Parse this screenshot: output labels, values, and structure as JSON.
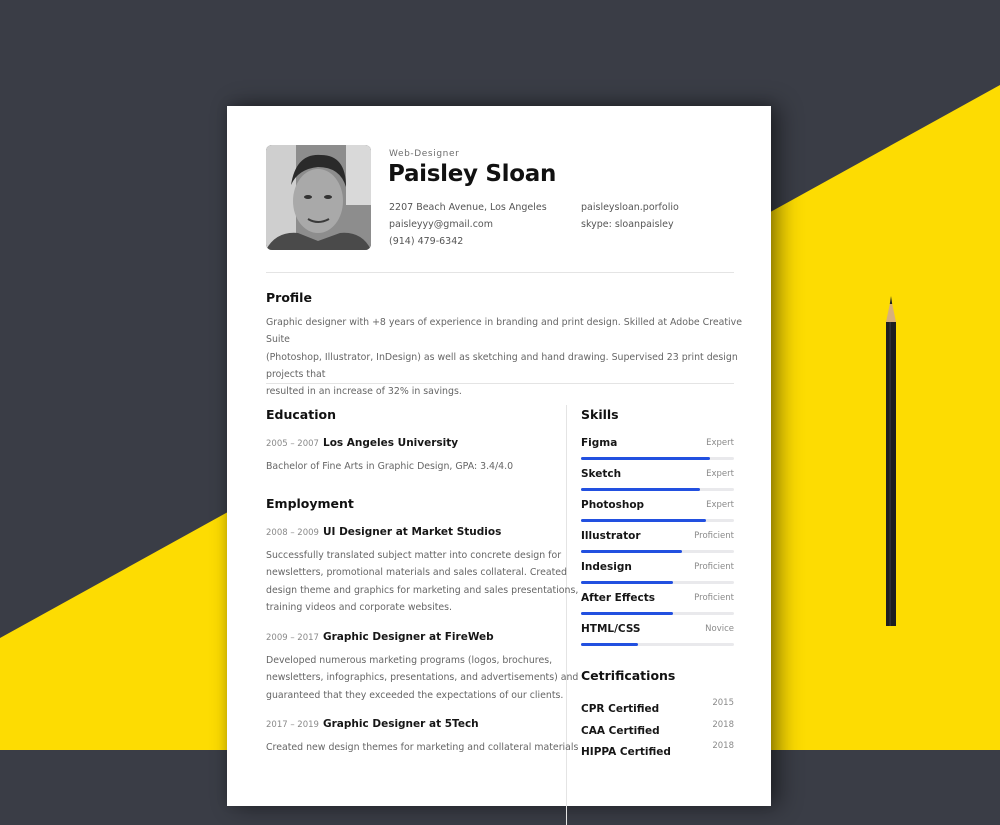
{
  "colors": {
    "background_dark": "#3a3d46",
    "background_yellow": "#fddc02",
    "accent_blue": "#2250e0",
    "paper": "#ffffff"
  },
  "header": {
    "role": "Web-Designer",
    "name": "Paisley Sloan",
    "address": "2207 Beach Avenue, Los Angeles",
    "email": "paisleyyy@gmail.com",
    "phone": "(914) 479-6342",
    "portfolio": "paisleysloan.porfolio",
    "skype": "skype: sloanpaisley"
  },
  "profile": {
    "title": "Profile",
    "lines": [
      "Graphic designer with +8 years of experience in branding and print design. Skilled at Adobe Creative Suite",
      "(Photoshop, Illustrator, InDesign) as well as sketching and hand drawing. Supervised 23 print design projects that",
      "resulted in an increase of 32% in savings."
    ]
  },
  "education": {
    "title": "Education",
    "items": [
      {
        "years": "2005 –  2007",
        "school": "Los Angeles University",
        "detail": "Bachelor of Fine Arts in Graphic Design, GPA: 3.4/4.0"
      }
    ]
  },
  "employment": {
    "title": "Employment",
    "items": [
      {
        "years": "2008 – 2009",
        "title": "UI Designer at Market Studios",
        "lines": [
          "Successfully translated subject matter into concrete design for",
          "newsletters, promotional materials and sales collateral. Created",
          "design theme and graphics for marketing and sales presentations,",
          "training videos and corporate websites."
        ]
      },
      {
        "years": "2009 – 2017",
        "title": "Graphic Designer at FireWeb",
        "lines": [
          "Developed numerous marketing programs (logos, brochures,",
          "newsletters, infographics, presentations, and advertisements) and",
          "guaranteed that they exceeded the expectations of our clients."
        ]
      },
      {
        "years": "2017 – 2019",
        "title": "Graphic Designer at 5Tech",
        "lines": [
          "Created new design themes for marketing and collateral materials"
        ]
      }
    ]
  },
  "skills": {
    "title": "Skills",
    "items": [
      {
        "name": "Figma",
        "level": "Expert",
        "percent": 84
      },
      {
        "name": "Sketch",
        "level": "Expert",
        "percent": 78
      },
      {
        "name": "Photoshop",
        "level": "Expert",
        "percent": 82
      },
      {
        "name": "Illustrator",
        "level": "Proficient",
        "percent": 66
      },
      {
        "name": "Indesign",
        "level": "Proficient",
        "percent": 60
      },
      {
        "name": "After Effects",
        "level": "Proficient",
        "percent": 60
      },
      {
        "name": "HTML/CSS",
        "level": "Novice",
        "percent": 37
      }
    ]
  },
  "certifications": {
    "title": "Cetrifications",
    "items": [
      {
        "name": "CPR Certified",
        "year": "2015"
      },
      {
        "name": "CAA Certified",
        "year": "2018"
      },
      {
        "name": "HIPPA Certified",
        "year": "2018"
      }
    ]
  }
}
